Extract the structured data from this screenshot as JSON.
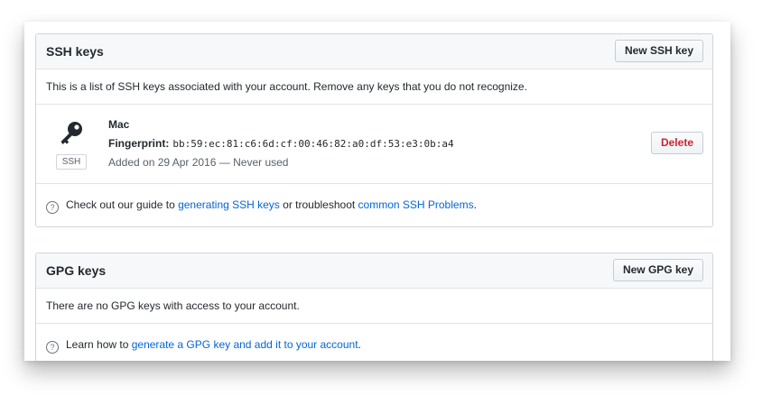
{
  "ssh": {
    "title": "SSH keys",
    "new_button": "New SSH key",
    "description": "This is a list of SSH keys associated with your account. Remove any keys that you do not recognize.",
    "key": {
      "name": "Mac",
      "fingerprint_label": "Fingerprint:",
      "fingerprint": "bb:59:ec:81:c6:6d:cf:00:46:82:a0:df:53:e3:0b:a4",
      "added": "Added on 29 Apr 2016 — Never used",
      "badge": "SSH",
      "delete_button": "Delete"
    },
    "help": {
      "icon": "?",
      "prefix": "Check out our guide to ",
      "link1": "generating SSH keys",
      "middle": " or troubleshoot ",
      "link2": "common SSH Problems",
      "suffix": "."
    }
  },
  "gpg": {
    "title": "GPG keys",
    "new_button": "New GPG key",
    "description": "There are no GPG keys with access to your account.",
    "help": {
      "icon": "?",
      "prefix": "Learn how to ",
      "link": "generate a GPG key and add it to your account",
      "suffix": "."
    }
  },
  "colors": {
    "link": "#0366d6",
    "danger": "#cb2431",
    "header_bg": "#f6f8fa",
    "border": "#d1d5da"
  },
  "icons": {
    "key": "key-icon",
    "help": "question-circle-icon"
  }
}
